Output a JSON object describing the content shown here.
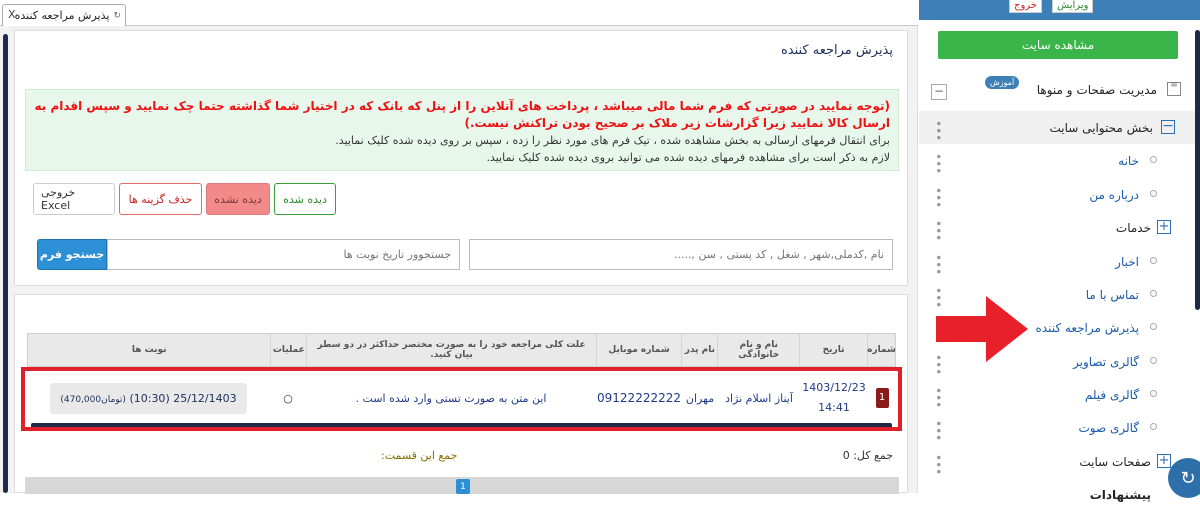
{
  "tab": {
    "title": "پذیرش مراجعه کننده",
    "close": "X"
  },
  "panel": {
    "title": "پذیرش مراجعه کننده"
  },
  "alert": {
    "warning": "(توجه نمایید در صورتی که فرم شما مالی میباشد ، پرداخت های آنلاین را از پنل که بانک که در اختیار شما گذاشته حتما چک نمایید و سپس اقدام به ارسال کالا نمایید زیرا گزارشات زیر ملاک بر صحیح بودن تراکنش نیست.)",
    "line1": "برای انتقال فرمهای ارسالی به بخش مشاهده شده ، تیک فرم های مورد نظر را زده ، سپس بر روی دیده شده کلیک نمایید.",
    "line2": "لازم به ذکر است برای مشاهده فرمهای دیده شده می توانید بروی دیده شده کلیک نمایید."
  },
  "buttons": {
    "excel": "خروجی Excel",
    "delete": "حذف گزینه ها",
    "unseen": "دیده نشده",
    "seen": "دیده شده",
    "search": "جستجو فرم"
  },
  "inputs": {
    "name_placeholder": "نام ,کدملی,شهر , شغل , کد پستی , سن ,.....",
    "date_placeholder": "جستجوور تاریخ نوبت ها"
  },
  "table": {
    "headers": [
      "شماره",
      "تاریخ",
      "نام و نام خانوادگی",
      "نام پدر",
      "شماره موبایل",
      "علت کلی مراجعه خود را به صورت مختصر حداکثر در دو سطر بیان کنید.",
      "عملیات",
      "نوبت ها"
    ],
    "row": {
      "num": "1",
      "date": "1403/12/23",
      "time": "14:41",
      "name": "آیناز اسلام نژاد",
      "father": "مهران",
      "mobile": "09122222222",
      "reason": "این متن به صورت تستی وارد شده است .",
      "op_icon": "○",
      "queue": "25/12/1403 (10:30)",
      "price": "(470,000تومان)"
    }
  },
  "footer": {
    "total": "جمع کل: 0",
    "section_sum": "جمع این قسمت:",
    "page": "1"
  },
  "sidebar": {
    "top_buttons": {
      "edit": "ویرایش",
      "logout": "خروج"
    },
    "view_site": "مشاهده سایت",
    "menu_pages": "مدیریت صفحات و منوها",
    "badge": "آموزش",
    "content_section": "بخش محتوایی سایت",
    "items": [
      "خانه",
      "درباره من",
      "خدمات",
      "اخبار",
      "تماس با ما",
      "پذیرش مراجعه کننده",
      "گالری تصاویر",
      "گالری فیلم",
      "گالری صوت"
    ],
    "site_pages": "صفحات سایت",
    "last": "پیشنهادات"
  },
  "colors": {
    "accent_blue": "#2d8fd5",
    "green": "#3ab54a",
    "alert_red": "#e11111",
    "highlight_red": "#e0202a"
  }
}
